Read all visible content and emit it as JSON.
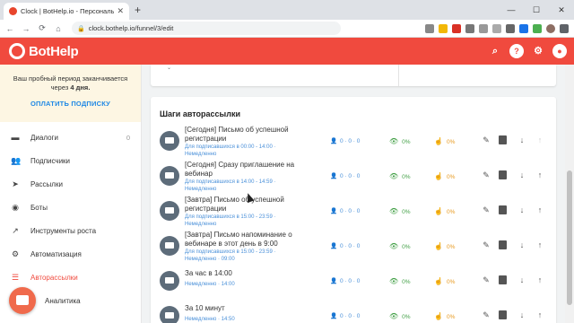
{
  "browser": {
    "tab_title": "Clock | BotHelp.io - Персональ",
    "tab_close": "✕",
    "new_tab": "+",
    "url": "clock.bothelp.io/funnel/3/edit",
    "window_controls": [
      "—",
      "☐",
      "✕"
    ],
    "nav": [
      "←",
      "→",
      "⟳",
      "⌂"
    ]
  },
  "app": {
    "brand": "BotHelp",
    "brand_color": "#f04a3e",
    "header_icons": [
      "search-icon",
      "help-icon",
      "gear-icon",
      "account-icon"
    ]
  },
  "sidebar": {
    "trial_text_1": "Ваш пробный период заканчивается",
    "trial_text_2": "через",
    "trial_days": "4 дня.",
    "pay_link": "ОПЛАТИТЬ ПОДПИСКУ",
    "items": [
      {
        "label": "Диалоги",
        "count": "0",
        "icon": "chat-icon"
      },
      {
        "label": "Подписчики",
        "count": "",
        "icon": "people-icon"
      },
      {
        "label": "Рассылки",
        "count": "",
        "icon": "send-icon"
      },
      {
        "label": "Боты",
        "count": "",
        "icon": "bot-icon"
      },
      {
        "label": "Инструменты роста",
        "count": "",
        "icon": "trend-icon"
      },
      {
        "label": "Автоматизация",
        "count": "",
        "icon": "automation-icon"
      },
      {
        "label": "Авторассылки",
        "count": "",
        "icon": "autosend-icon"
      },
      {
        "label": "Аналитика",
        "count": "",
        "icon": "analytics-icon"
      }
    ],
    "active_index": 6
  },
  "steps": {
    "title": "Шаги авторассылки",
    "rows": [
      {
        "name": "[Сегодня] Письмо об успешной регистрации",
        "audience": "Для подписавшихся в 00:00 - 14:00 ·",
        "timing": "Немедленно",
        "users": "0 · 0 · 0",
        "views": "0%",
        "clicks": "0%",
        "up_enabled": false
      },
      {
        "name": "[Сегодня] Сразу приглашение на вебинар",
        "audience": "Для подписавшихся в 14:00 - 14:59 ·",
        "timing": "Немедленно",
        "users": "0 · 0 · 0",
        "views": "0%",
        "clicks": "0%",
        "up_enabled": true
      },
      {
        "name": "[Завтра] Письмо об успешной регистрации",
        "audience": "Для подписавшихся в 15:00 - 23:59 ·",
        "timing": "Немедленно",
        "users": "0 · 0 · 0",
        "views": "0%",
        "clicks": "0%",
        "up_enabled": true
      },
      {
        "name": "[Завтра] Письмо напоминание о вебинаре в этот день в 9:00",
        "audience": "Для подписавшихся в 15:00 - 23:59 ·",
        "timing": "Немедленно · 09:00",
        "users": "0 · 0 · 0",
        "views": "0%",
        "clicks": "0%",
        "up_enabled": true
      },
      {
        "name": "За час в 14:00",
        "audience": "",
        "timing": "Немедленно · 14:00",
        "users": "0 · 0 · 0",
        "views": "0%",
        "clicks": "0%",
        "up_enabled": true
      },
      {
        "name": "За 10 минут",
        "audience": "",
        "timing": "Немедленно · 14:50",
        "users": "0 · 0 · 0",
        "views": "0%",
        "clicks": "0%",
        "up_enabled": true
      }
    ]
  }
}
